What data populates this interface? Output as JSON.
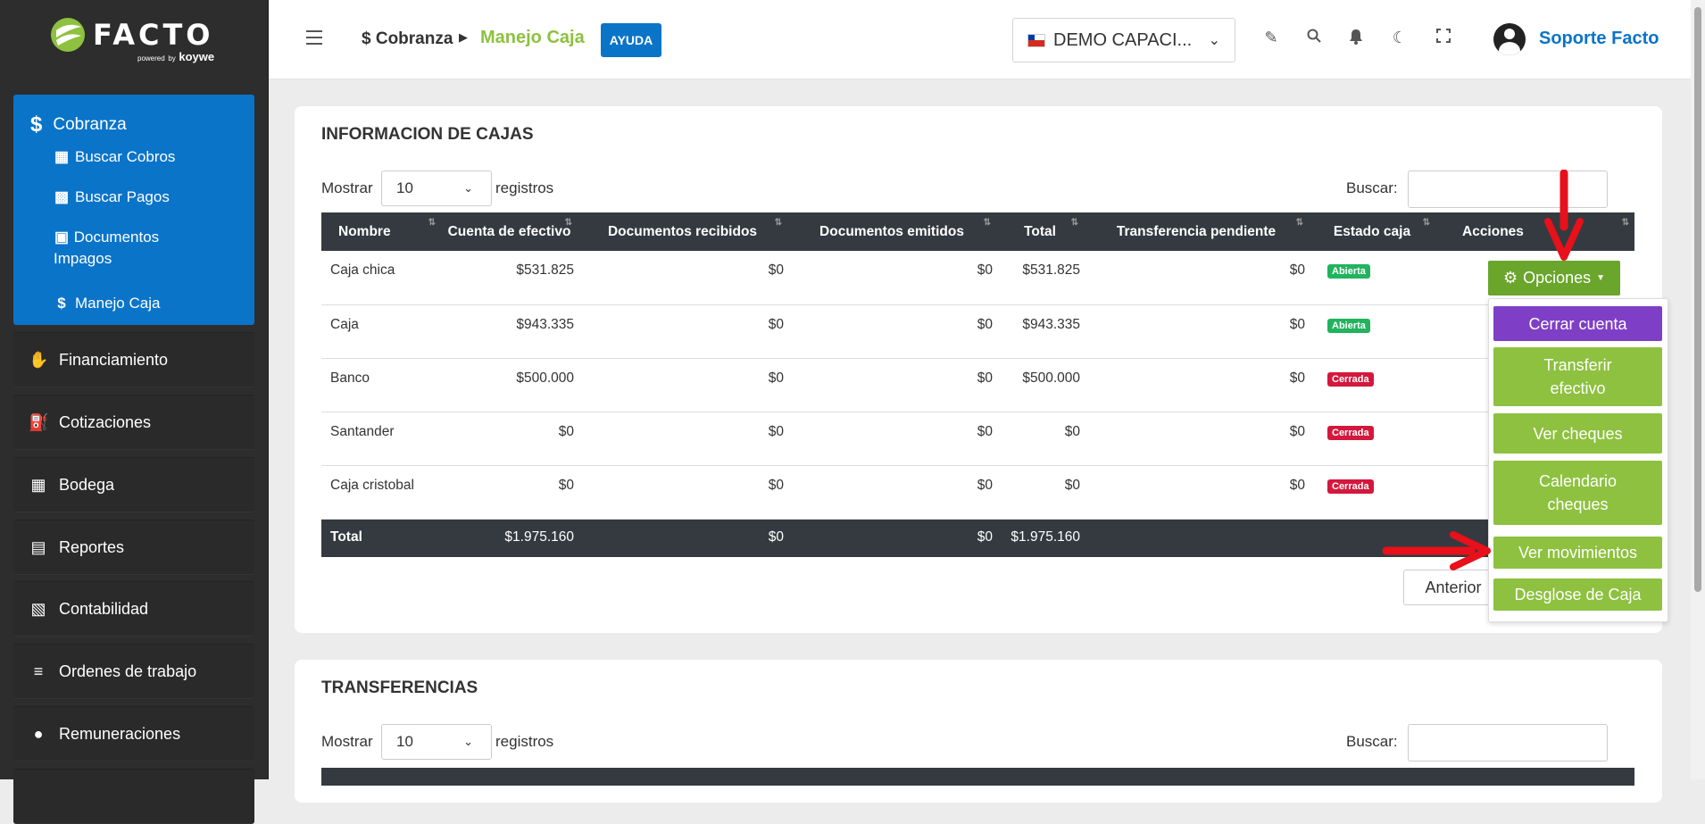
{
  "sidebar": {
    "logo_text": "FACTO",
    "logo_powered": "powered",
    "logo_by": "by",
    "logo_brand": "koywe",
    "active_section": "Cobranza",
    "sub_items": [
      {
        "label": "Buscar Cobros",
        "icon": "table-icon"
      },
      {
        "label": "Buscar Pagos",
        "icon": "money-icon"
      },
      {
        "label": "Documentos Impagos",
        "icon": "wallet-icon"
      },
      {
        "label": "Manejo Caja",
        "icon": "dollar-icon"
      }
    ],
    "items": [
      {
        "label": "Financiamiento",
        "icon": "hand-money-icon"
      },
      {
        "label": "Cotizaciones",
        "icon": "cart-icon"
      },
      {
        "label": "Bodega",
        "icon": "boxes-icon"
      },
      {
        "label": "Reportes",
        "icon": "chart-icon"
      },
      {
        "label": "Contabilidad",
        "icon": "calculator-icon"
      },
      {
        "label": "Ordenes de trabajo",
        "icon": "tasks-icon"
      },
      {
        "label": "Remuneraciones",
        "icon": "users-icon"
      }
    ]
  },
  "header": {
    "breadcrumb_parent": "$ Cobranza",
    "breadcrumb_current": "Manejo Caja",
    "help_label": "AYUDA",
    "company": "DEMO CAPACI...",
    "user_name": "Soporte Facto"
  },
  "cajas": {
    "title": "INFORMACION DE CAJAS",
    "show_label": "Mostrar",
    "page_length": "10",
    "records_label": "registros",
    "search_label": "Buscar:",
    "columns": [
      "Nombre",
      "Cuenta de efectivo",
      "Documentos recibidos",
      "Documentos emitidos",
      "Total",
      "Transferencia pendiente",
      "Estado caja",
      "Acciones"
    ],
    "rows": [
      {
        "nombre": "Caja chica",
        "efectivo": "$531.825",
        "recibidos": "$0",
        "emitidos": "$0",
        "total": "$531.825",
        "transferencia": "$0",
        "estado": "Abierta"
      },
      {
        "nombre": "Caja",
        "efectivo": "$943.335",
        "recibidos": "$0",
        "emitidos": "$0",
        "total": "$943.335",
        "transferencia": "$0",
        "estado": "Abierta"
      },
      {
        "nombre": "Banco",
        "efectivo": "$500.000",
        "recibidos": "$0",
        "emitidos": "$0",
        "total": "$500.000",
        "transferencia": "$0",
        "estado": "Cerrada"
      },
      {
        "nombre": "Santander",
        "efectivo": "$0",
        "recibidos": "$0",
        "emitidos": "$0",
        "total": "$0",
        "transferencia": "$0",
        "estado": "Cerrada"
      },
      {
        "nombre": "Caja cristobal",
        "efectivo": "$0",
        "recibidos": "$0",
        "emitidos": "$0",
        "total": "$0",
        "transferencia": "$0",
        "estado": "Cerrada"
      }
    ],
    "totals": {
      "label": "Total",
      "efectivo": "$1.975.160",
      "recibidos": "$0",
      "emitidos": "$0",
      "total": "$1.975.160"
    },
    "options_label": "Opciones",
    "options_menu": [
      "Cerrar cuenta",
      "Transferir efectivo",
      "Ver cheques",
      "Calendario cheques",
      "Ver movimientos",
      "Desglose de Caja"
    ],
    "prev_label": "Anterior"
  },
  "transferencias": {
    "title": "TRANSFERENCIAS",
    "show_label": "Mostrar",
    "page_length": "10",
    "records_label": "registros",
    "search_label": "Buscar:"
  },
  "colors": {
    "sidebar_bg": "#2d2d2d",
    "accent_blue": "#0a74c9",
    "accent_green": "#8dc13f",
    "purple": "#7e3fc6",
    "badge_open": "#22b35e",
    "badge_closed": "#d3183d",
    "annotation_arrow": "#e8101a"
  }
}
